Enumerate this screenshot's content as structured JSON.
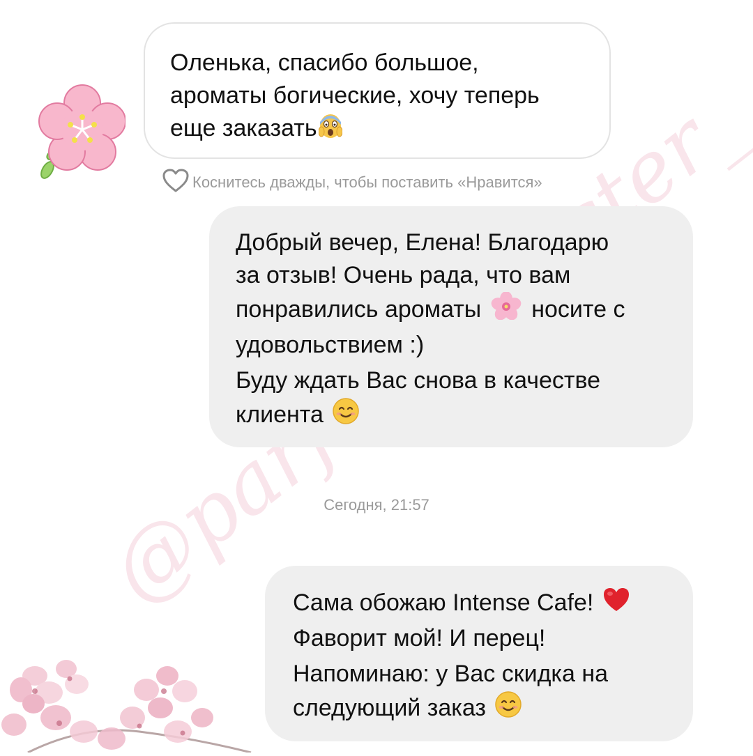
{
  "watermark": "@parfume_tester_",
  "incoming_message": {
    "text_lines": [
      "Оленька, спасибо большое,",
      "ароматы богические, хочу теперь",
      "еще заказать"
    ],
    "trailing_emoji": "screaming-face-emoji"
  },
  "like_hint": {
    "icon": "heart-outline-icon",
    "text": "Коснитесь дважды, чтобы поставить «Нравится»"
  },
  "outgoing_message_1": {
    "lines": [
      "Добрый вечер, Елена! Благодарю",
      "за отзыв! Очень рада, что вам",
      "понравились ароматы",
      "носите с",
      "удовольствием :)",
      "Буду ждать Вас снова в качестве",
      "клиента"
    ],
    "emojis": [
      "cherry-blossom-emoji",
      "smiling-face-emoji"
    ]
  },
  "timestamp": "Сегодня, 21:57",
  "outgoing_message_2": {
    "lines": [
      "Сама обожаю Intense Cafe!",
      "Фаворит мой! И перец!",
      "Напоминаю: у Вас скидка на",
      "следующий заказ"
    ],
    "emojis": [
      "red-heart-emoji",
      "smiling-face-emoji"
    ]
  },
  "colors": {
    "background": "#ffffff",
    "incoming_border": "#e3e3e3",
    "outgoing_bubble": "#efefef",
    "meta_text": "#9a9a9a",
    "watermark": "#eeaabe",
    "flower_pink": "#f8b7cc"
  }
}
